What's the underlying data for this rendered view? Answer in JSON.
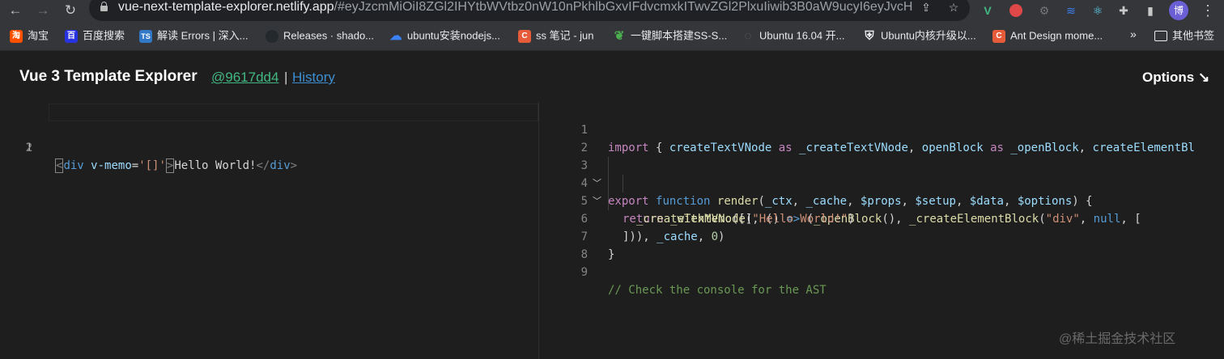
{
  "browser": {
    "url_host": "vue-next-template-explorer.netlify.app",
    "url_path": "/#eyJzcmMiOiI8ZGl2IHYtbWVtbz0nW10nPkhlbGxvIFdvcmxkITwvZGl2PlxuIiwib3B0aW9ucyI6eyJvcH",
    "avatar_text": "博"
  },
  "bookmarks": [
    {
      "label": "淘宝",
      "icon": "taobao-icon",
      "color": "#ff5000",
      "glyph": "淘"
    },
    {
      "label": "百度搜索",
      "icon": "baidu-icon",
      "color": "#2932e1",
      "glyph": "百"
    },
    {
      "label": "解读 Errors | 深入...",
      "icon": "typescript-icon",
      "color": "#3178c6",
      "glyph": "TS"
    },
    {
      "label": "Releases · shado...",
      "icon": "github-icon",
      "color": "#24292e",
      "glyph": ""
    },
    {
      "label": "ubuntu安装nodejs...",
      "icon": "cloud-icon",
      "color": "#3b82f6",
      "glyph": "☁"
    },
    {
      "label": "ss 笔记 - jun",
      "icon": "csdn-icon",
      "color": "#e65c3b",
      "glyph": "C"
    },
    {
      "label": "一键脚本搭建SS-S...",
      "icon": "leaf-icon",
      "color": "#4caf50",
      "glyph": "❦"
    },
    {
      "label": "Ubuntu 16.04 开...",
      "icon": "spinner-icon",
      "color": "#35363a",
      "glyph": "◌"
    },
    {
      "label": "Ubuntu内核升级以...",
      "icon": "shield-icon",
      "color": "#e8eaed",
      "glyph": "⛨"
    },
    {
      "label": "Ant Design mome...",
      "icon": "csdn-icon",
      "color": "#e65c3b",
      "glyph": "C"
    }
  ],
  "bookmarks_more": "»",
  "bookmarks_other": "其他书签",
  "header": {
    "title": "Vue 3 Template Explorer",
    "commit_link": "@9617dd4",
    "separator": "|",
    "history_link": "History",
    "options": "Options ↘"
  },
  "template_editor": {
    "line_numbers": [
      "1",
      "2"
    ]
  },
  "output_editor": {
    "line_numbers": [
      "1",
      "2",
      "3",
      "4",
      "5",
      "6",
      "7",
      "8",
      "9"
    ]
  },
  "watermark": "@稀土掘金技术社区",
  "colors": {
    "vue_green": "#42b883",
    "link_blue": "#3d8fd1",
    "background": "#1e1e1e"
  }
}
